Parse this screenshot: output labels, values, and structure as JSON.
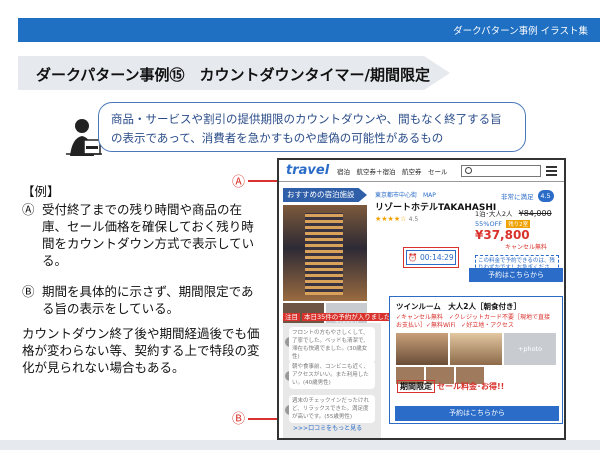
{
  "header": {
    "subtitle": "ダークパターン事例 イラスト集"
  },
  "title": "ダークパターン事例⑮　カウントダウンタイマー/期間限定",
  "definition": "商品・サービスや割引の提供期限のカウントダウンや、間もなく終了する旨の表示であって、消費者を急かすものや虚偽の可能性があるもの",
  "example": {
    "heading": "【例】",
    "items": [
      {
        "mark": "Ⓐ",
        "text": "受付終了までの残り時間や商品の在庫、セール価格を確保しておく残り時間をカウントダウン方式で表示している。"
      },
      {
        "mark": "Ⓑ",
        "text": "期間を具体的に示さず、期間限定である旨の表示をしている。"
      }
    ],
    "note": "カウントダウン終了後や期間経過後でも価格が変わらない等、契約する上で特段の変化が見られない場合もある。"
  },
  "labels": {
    "a": "Ⓐ",
    "b": "Ⓑ"
  },
  "mock": {
    "logo": "travel",
    "menu": "宿泊　航空券＋宿泊　航空券　セール",
    "recommend": "おすすめの宿泊施設",
    "photo_label": "+photo",
    "hotel": {
      "category": "東京都市中心街　MAP",
      "name": "リゾートホテルTAKAHASHI",
      "stars": "★★★★☆",
      "rating": "4.5",
      "discount": "55%OFF",
      "tag": "残り2室"
    },
    "price": {
      "review_label": "非常に満足",
      "review_score": "4.5",
      "guests": "1泊･大人2人",
      "old": "¥84,000",
      "new": "¥37,800",
      "cancel": "キャンセル無料",
      "warning": "この料金で予約できるのは、残りわずかです！お急ぎください！"
    },
    "timer": "⏰ 00:14:29",
    "cta": "予約はこちらから",
    "booked": "本日35件の予約が入りました!!",
    "booked_tag": "注目",
    "reviews": [
      "フロントの方もやさしくして、了寧でした。ベッドも清潔で、滞在も快適でました。(30歳女性)",
      "朝や食事前、コンビニも近く、アクセスがいい。また利用したい。(40歳男性)",
      "週末のチェックインだったけれど、リラックスできた。満足度が高いです。(55歳男性)"
    ],
    "reviews_more": ">>>口コミをもっと見る",
    "room": {
      "name": "ツインルーム　大人2人［朝食付き］",
      "features": "✓キャンセル無料　✓クレジットカード不要［現地で直接お支払い］✓無料WiFi　✓好立地・アクセス"
    },
    "limit_label": "期間限定",
    "limit_text": "セール料金･お得!!"
  },
  "colors": {
    "accent": "#2a6cc8",
    "alert": "#d9312b",
    "band": "#1f6fc2"
  }
}
